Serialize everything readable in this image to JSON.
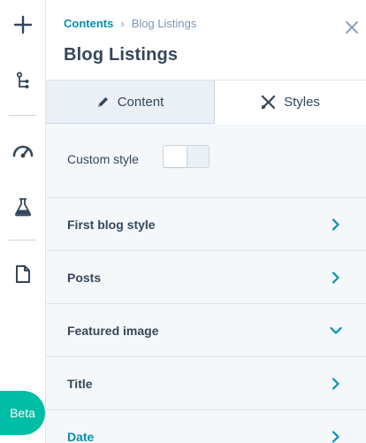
{
  "breadcrumb": {
    "parent": "Contents",
    "separator": "›",
    "current": "Blog Listings"
  },
  "header": {
    "title": "Blog Listings"
  },
  "tabs": [
    {
      "label": "Content",
      "icon": "pencil-icon",
      "active": false
    },
    {
      "label": "Styles",
      "icon": "scissors-icon",
      "active": true
    }
  ],
  "custom_style": {
    "label": "Custom style",
    "enabled": false
  },
  "sections": [
    {
      "label": "First blog style",
      "state": "collapsed"
    },
    {
      "label": "Posts",
      "state": "collapsed"
    },
    {
      "label": "Featured image",
      "state": "expanded"
    },
    {
      "label": "Title",
      "state": "collapsed"
    },
    {
      "label": "Date",
      "state": "collapsed"
    }
  ],
  "rail": {
    "icons": [
      "plus-icon",
      "tree-icon",
      "gauge-icon",
      "flask-icon",
      "document-icon"
    ],
    "beta_label": "Beta"
  },
  "colors": {
    "accent": "#0091ae",
    "text": "#33475b",
    "muted": "#7c98b6",
    "beta": "#00bda5",
    "tab_inactive_bg": "#eaf0f6",
    "panel_bg": "#f5f8fa"
  }
}
